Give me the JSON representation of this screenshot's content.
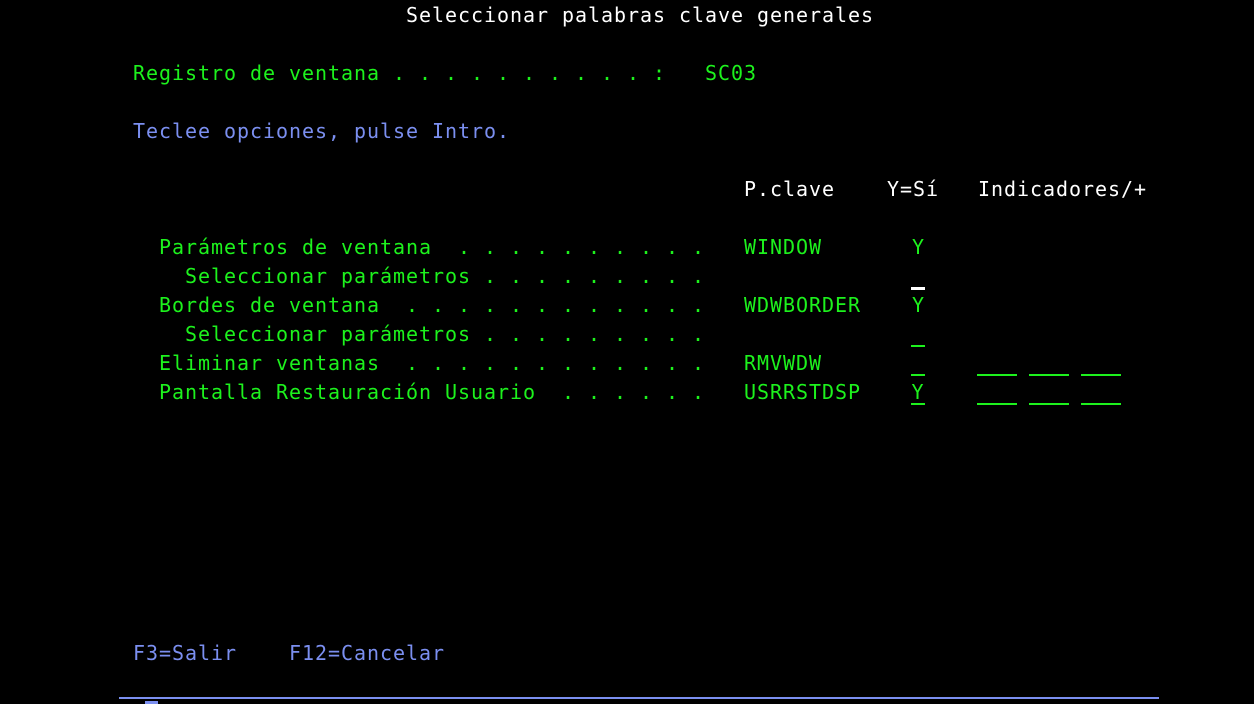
{
  "title": "Seleccionar palabras clave generales",
  "record_label": "Registro de ventana . . . . . . . . . . :",
  "record_value": "SC03",
  "instructions": "Teclee opciones, pulse Intro.",
  "headers": {
    "keyword": "P.clave",
    "yes": "Y=Sí",
    "indicators": "Indicadores/+"
  },
  "rows": [
    {
      "label": "Parámetros de ventana  . . . . . . . . . .",
      "keyword": "WINDOW",
      "value": "Y"
    },
    {
      "label": "Seleccionar parámetros . . . . . . . . .",
      "keyword": "",
      "value": ""
    },
    {
      "label": "Bordes de ventana  . . . . . . . . . . . .",
      "keyword": "WDWBORDER",
      "value": "Y"
    },
    {
      "label": "Seleccionar parámetros . . . . . . . . .",
      "keyword": "",
      "value": ""
    },
    {
      "label": "Eliminar ventanas  . . . . . . . . . . . .",
      "keyword": "RMVWDW",
      "value": ""
    },
    {
      "label": "Pantalla Restauración Usuario  . . . . . .",
      "keyword": "USRRSTDSP",
      "value": "Y"
    }
  ],
  "fkeys": {
    "f3": "F3=Salir",
    "f12": "F12=Cancelar"
  },
  "colors": {
    "green": "#1df21d",
    "blue": "#7b8ff0",
    "background": "#000000"
  }
}
